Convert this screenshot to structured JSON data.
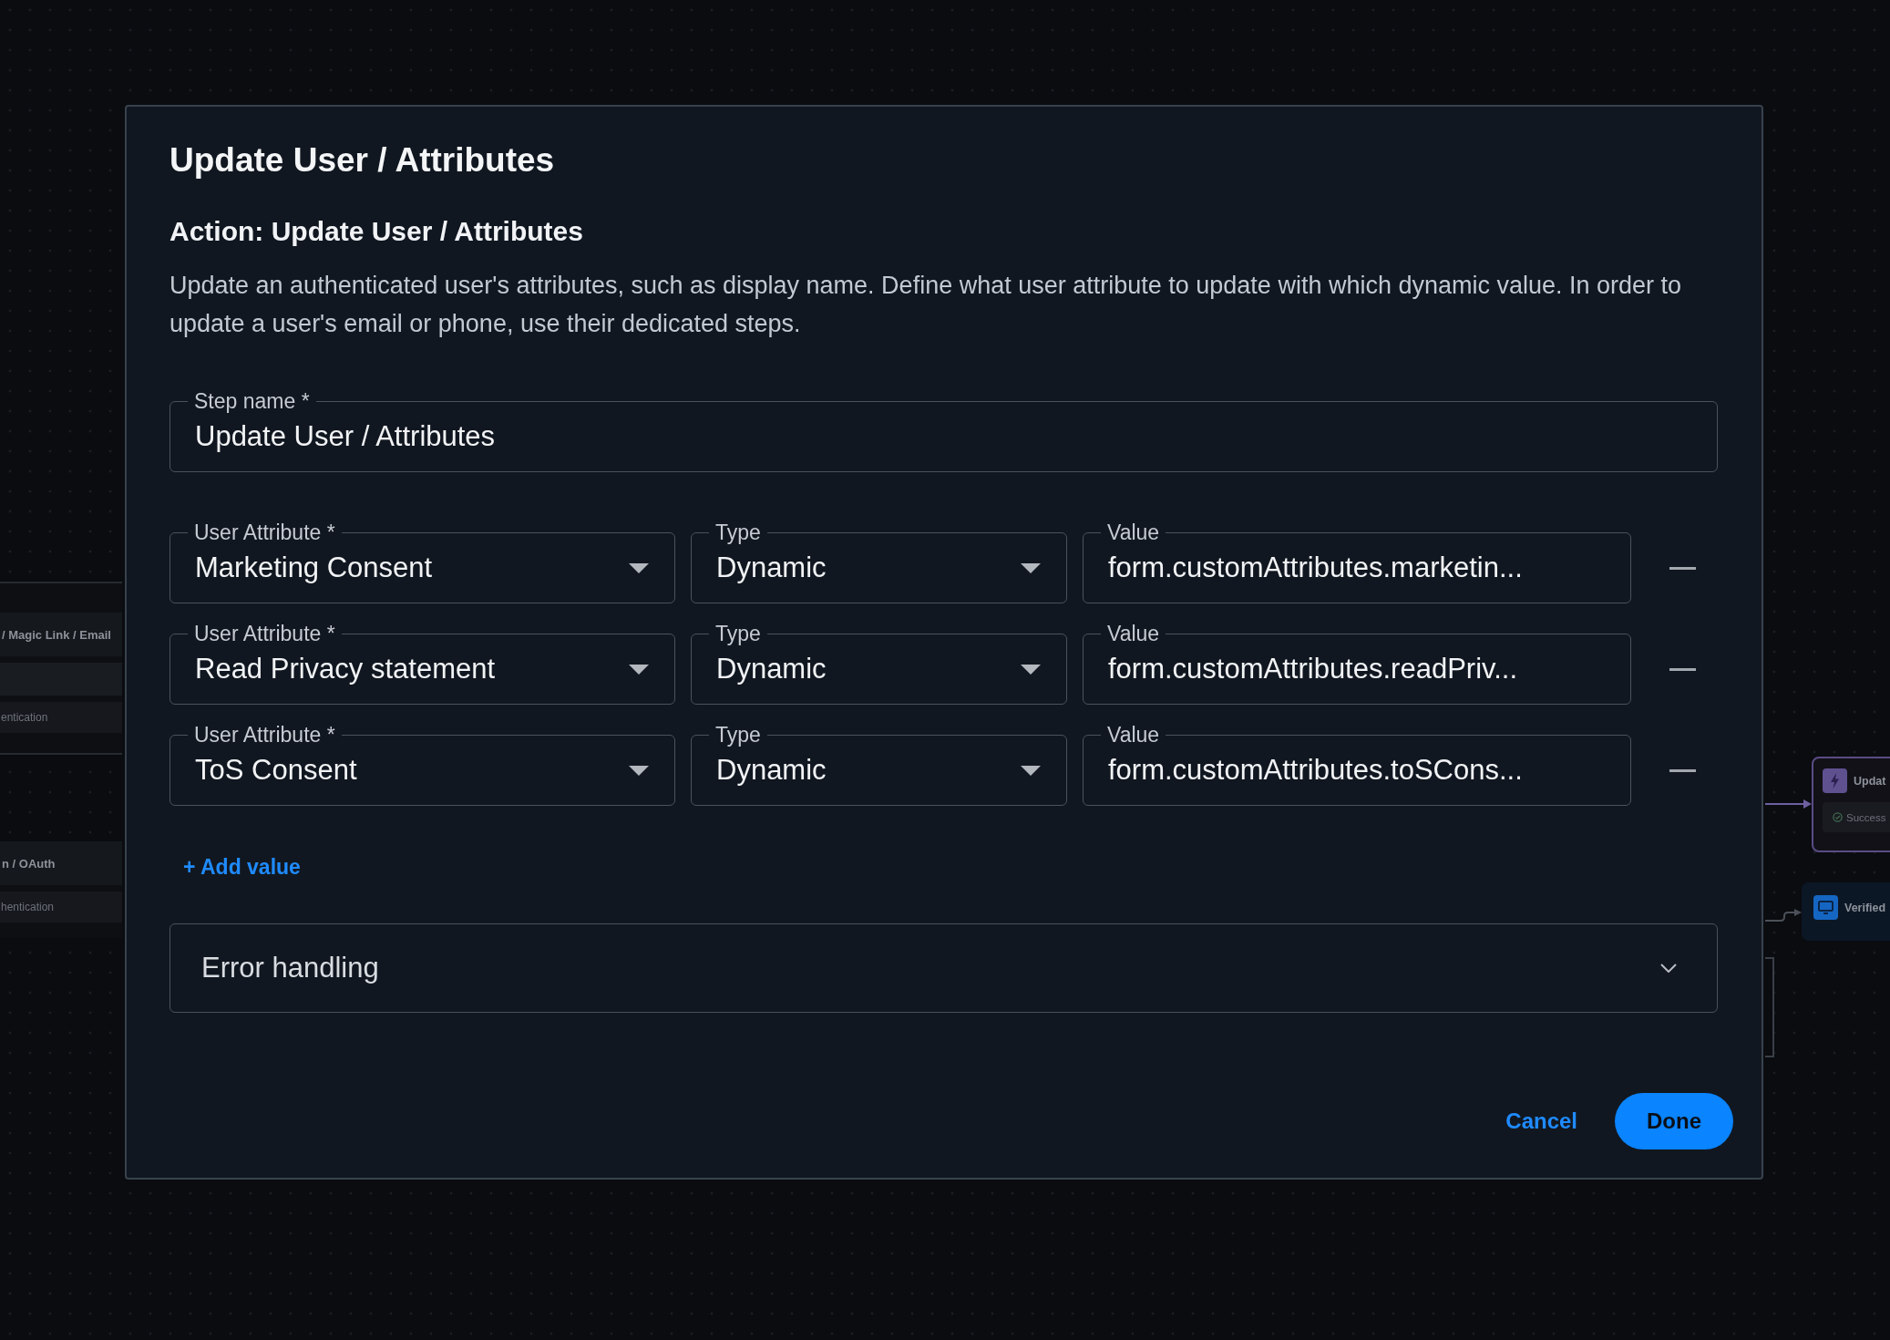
{
  "canvas": {
    "left_nodes": [
      {
        "title": "/ Magic Link / Email",
        "rows": [
          {
            "kind": "blank"
          },
          {
            "kind": "outcome",
            "label": "entication"
          }
        ]
      },
      {
        "title": "n / OAuth",
        "rows": [
          {
            "kind": "outcome",
            "label": "hentication"
          }
        ]
      }
    ],
    "right_nodes": [
      {
        "kind": "action",
        "title": "Updat",
        "rows": [
          {
            "kind": "success",
            "label": "Success"
          }
        ]
      },
      {
        "kind": "screen",
        "title": "Verified"
      }
    ]
  },
  "dialog": {
    "title": "Update User / Attributes",
    "section_title": "Action: Update User / Attributes",
    "description": "Update an authenticated user's attributes, such as display name. Define what user attribute to update with which dynamic value. In order to update a user's email or phone, use their dedicated steps.",
    "step_name": {
      "label": "Step name *",
      "value": "Update User / Attributes"
    },
    "attributes": [
      {
        "attribute": {
          "label": "User Attribute *",
          "value": "Marketing Consent"
        },
        "type": {
          "label": "Type",
          "value": "Dynamic"
        },
        "value": {
          "label": "Value",
          "value": "form.customAttributes.marketin..."
        }
      },
      {
        "attribute": {
          "label": "User Attribute *",
          "value": "Read Privacy statement"
        },
        "type": {
          "label": "Type",
          "value": "Dynamic"
        },
        "value": {
          "label": "Value",
          "value": "form.customAttributes.readPriv..."
        }
      },
      {
        "attribute": {
          "label": "User Attribute *",
          "value": "ToS Consent"
        },
        "type": {
          "label": "Type",
          "value": "Dynamic"
        },
        "value": {
          "label": "Value",
          "value": "form.customAttributes.toSCons..."
        }
      }
    ],
    "add_value": "+ Add value",
    "error_handling": {
      "label": "Error handling",
      "expanded": false
    },
    "buttons": {
      "cancel": "Cancel",
      "done": "Done"
    }
  }
}
